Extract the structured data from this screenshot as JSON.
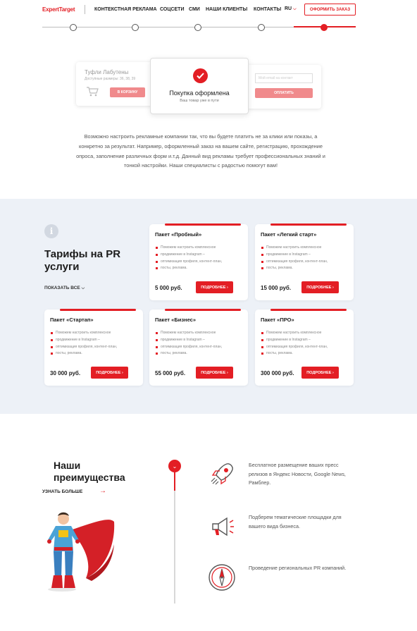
{
  "header": {
    "logo": "ExpertTarget",
    "nav": [
      "КОНТЕКСТНАЯ РЕКЛАМА",
      "СОЦСЕТИ",
      "СМИ",
      "НАШИ КЛИЕНТЫ",
      "КОНТАКТЫ"
    ],
    "lang": "RU",
    "order_button": "ОФОРМИТЬ ЗАКАЗ"
  },
  "progress": {
    "steps": 5,
    "active_step": 5
  },
  "illustration": {
    "product_title": "Туфли Лабутены",
    "product_sizes": "Доступные размеры: 36, 38, 39",
    "cart_button": "В КОРЗИНУ",
    "success_title": "Покупка оформлена",
    "success_sub": "Ваш товар уже в пути",
    "input_placeholder": "Мой email на контакт",
    "submit_button": "ОПЛАТИТЬ"
  },
  "intro": "Возможно настроить рекламные компании так, что вы будете платить не за клики или показы, а конкретно за результат. Например, оформленный заказ на вашем сайте, регистрацию, прохождение опроса, заполнение различных форм и.т.д. Данный вид рекламы требует профессиональных знаний и тонкой настройки. Наши специалисты с радостью помогут вам!",
  "tariffs": {
    "title": "Тарифы на PR услуги",
    "show_all": "ПОКАЗАТЬ ВСЕ",
    "more_label": "ПОДРОБНЕЕ",
    "packages": [
      {
        "name": "Пакет «Пробный»",
        "price": "5 000 руб.",
        "features": [
          "Поможем настроить комплексное",
          "продвижение в Instagram –",
          "оптимизация профиля, контент-план,",
          "посты, реклама."
        ]
      },
      {
        "name": "Пакет «Легкий старт»",
        "price": "15 000 руб.",
        "features": [
          "Поможем настроить комплексное",
          "продвижение в Instagram –",
          "оптимизация профиля, контент-план,",
          "посты, реклама."
        ]
      },
      {
        "name": "Пакет «Стартап»",
        "price": "30 000 руб.",
        "features": [
          "Поможем настроить комплексное",
          "продвижение в Instagram –",
          "оптимизация профиля, контент-план,",
          "посты, реклама."
        ]
      },
      {
        "name": "Пакет «Бизнес»",
        "price": "55 000 руб.",
        "features": [
          "Поможем настроить комплексное",
          "продвижение в Instagram –",
          "оптимизация профиля, контент-план,",
          "посты, реклама."
        ]
      },
      {
        "name": "Пакет «ПРО»",
        "price": "300 000 руб.",
        "features": [
          "Поможем настроить комплексное",
          "продвижение в Instagram –",
          "оптимизация профиля, контент-план,",
          "посты, реклама."
        ]
      }
    ]
  },
  "advantages": {
    "title": "Наши преимущества",
    "learn_more": "УЗНАТЬ БОЛЬШЕ",
    "items": [
      {
        "icon": "rocket-icon",
        "text": "Бесплатное размещение ваших пресс релизов в Яндекс Новости, Google News, Рамблер."
      },
      {
        "icon": "megaphone-icon",
        "text": "Подберем тематические площадки для вашего вида бизнеса."
      },
      {
        "icon": "compass-icon",
        "text": "Проведение региональных PR компаний."
      }
    ]
  },
  "colors": {
    "accent": "#e31e24",
    "section_bg": "#edf1f7"
  }
}
